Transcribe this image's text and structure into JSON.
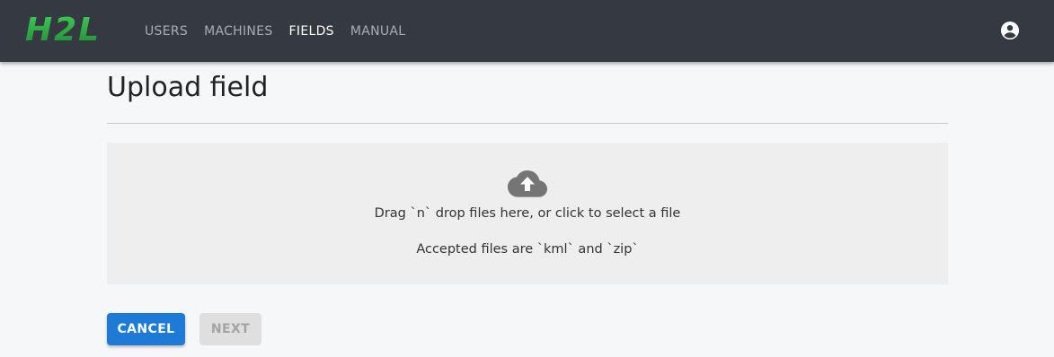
{
  "appbar": {
    "logo_text": "H2L",
    "nav": [
      {
        "label": "USERS",
        "active": false
      },
      {
        "label": "MACHINES",
        "active": false
      },
      {
        "label": "FIELDS",
        "active": true
      },
      {
        "label": "MANUAL",
        "active": false
      }
    ],
    "account_icon": "account-circle-icon"
  },
  "page": {
    "title": "Upload field"
  },
  "dropzone": {
    "icon": "cloud-upload-icon",
    "instruction": "Drag `n` drop files here, or click to select a file",
    "accepted": "Accepted files are `kml` and `zip`"
  },
  "actions": {
    "cancel_label": "CANCEL",
    "next_label": "NEXT",
    "next_disabled": true
  },
  "colors": {
    "appbar": "#353a42",
    "logo_green": "#2fb54a",
    "primary": "#1d7ad6",
    "background": "#f6f7f9"
  }
}
